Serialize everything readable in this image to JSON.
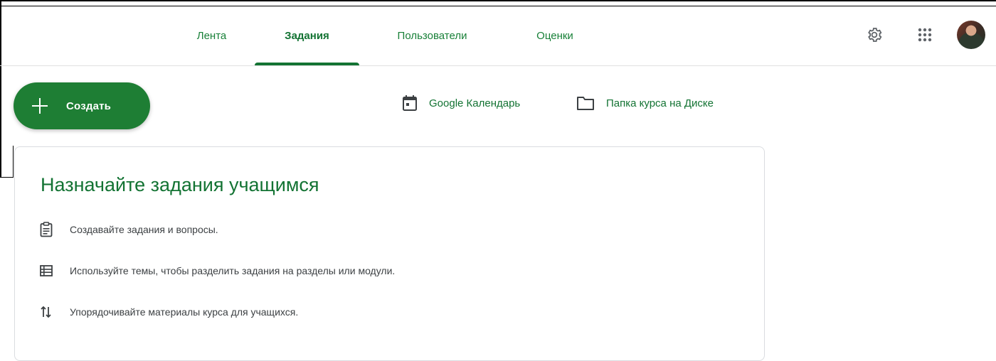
{
  "nav": {
    "tabs": [
      {
        "label": "Лента",
        "active": false
      },
      {
        "label": "Задания",
        "active": true
      },
      {
        "label": "Пользователи",
        "active": false
      },
      {
        "label": "Оценки",
        "active": false
      }
    ],
    "icons": [
      "gear-icon",
      "apps-grid-icon",
      "avatar"
    ]
  },
  "actions": {
    "create_label": "Создать",
    "calendar_label": "Google Календарь",
    "drive_label": "Папка курса на Диске"
  },
  "card": {
    "title": "Назначайте задания учащимся",
    "rows": [
      {
        "icon": "assignment-icon",
        "text": "Создавайте задания и вопросы."
      },
      {
        "icon": "topic-list-icon",
        "text": "Используйте темы, чтобы разделить задания на разделы или модули."
      },
      {
        "icon": "reorder-icon",
        "text": "Упорядочивайте материалы курса для учащихся."
      }
    ]
  },
  "colors": {
    "accent": "#137333",
    "create_button": "#1e7e34"
  }
}
